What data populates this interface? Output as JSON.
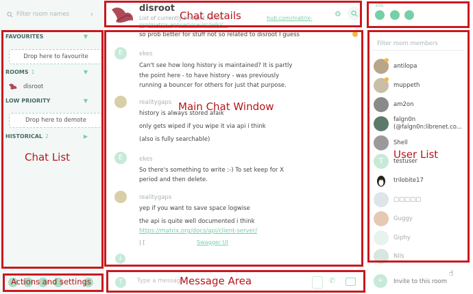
{
  "left_panel": {
    "search_placeholder": "Filter room names",
    "favourites": {
      "label": "FAVOURITES",
      "drop_text": "Drop here to favourite"
    },
    "rooms": {
      "label": "ROOMS",
      "count": "1",
      "items": [
        {
          "name": "disroot"
        }
      ]
    },
    "low_priority": {
      "label": "LOW PRIORITY",
      "drop_text": "Drop here to demote"
    },
    "historical": {
      "label": "HISTORICAL",
      "count": "2"
    }
  },
  "header": {
    "room_name": "disroot",
    "topic": "List of currently bridged rooms",
    "topic_link": "hub.com/matrix-",
    "topic_link2": "org/matrix-appservice-irc/wiki/..."
  },
  "chat": {
    "top_line": "so prob better for stuff not so related to disroot I guess",
    "messages": [
      {
        "sender": "ekes",
        "avatar_letter": "E",
        "lines": [
          "Can't see how long history is maintained? It is partly",
          "the point here - to have history - was previously",
          "running a bouncer for others for just that purpose."
        ]
      },
      {
        "sender": "realitygaps",
        "lines": [
          "history is always stored afaik",
          "only gets wiped if you wipe it via api i think",
          "(also is fully searchable)"
        ]
      },
      {
        "sender": "ekes",
        "avatar_letter": "E",
        "lines": [
          "So there's something to write :-) To set keep for X",
          "period and then delete."
        ]
      },
      {
        "sender": "realitygaps",
        "lines": [
          "yep if you want to save space logwise",
          "the api is quite well documented i think"
        ],
        "link": "https://matrix.org/docs/api/client-server/",
        "trailing": "Swagger UI"
      }
    ]
  },
  "composer": {
    "placeholder": "Type a message…",
    "avatar_letter": "T"
  },
  "right_panel": {
    "member_count": "105",
    "filter_placeholder": "Filter room members",
    "members": [
      {
        "name": "antilopa"
      },
      {
        "name": "muppeth"
      },
      {
        "name": "am2on"
      },
      {
        "name": "falgn0n",
        "sub": "(@falgn0n:librenet.co..."
      },
      {
        "name": "Shell"
      },
      {
        "name": "testuser",
        "letter": "T"
      },
      {
        "name": "trilobite17"
      },
      {
        "name": "□□□□□"
      },
      {
        "name": "Guggy"
      },
      {
        "name": "Giphy"
      },
      {
        "name": "Nils"
      }
    ],
    "invite_label": "Invite to this room"
  },
  "annotations": {
    "chat_details": "Chat details",
    "main_chat_window": "Main Chat Window",
    "chat_list": "Chat List",
    "user_list": "User List",
    "actions_and_settings": "Actions and settings",
    "message_area": "Message Area"
  },
  "colors": {
    "accent": "#76cfa6",
    "annotation_red": "#c8181e",
    "panel_bg": "#f3f8f7"
  }
}
